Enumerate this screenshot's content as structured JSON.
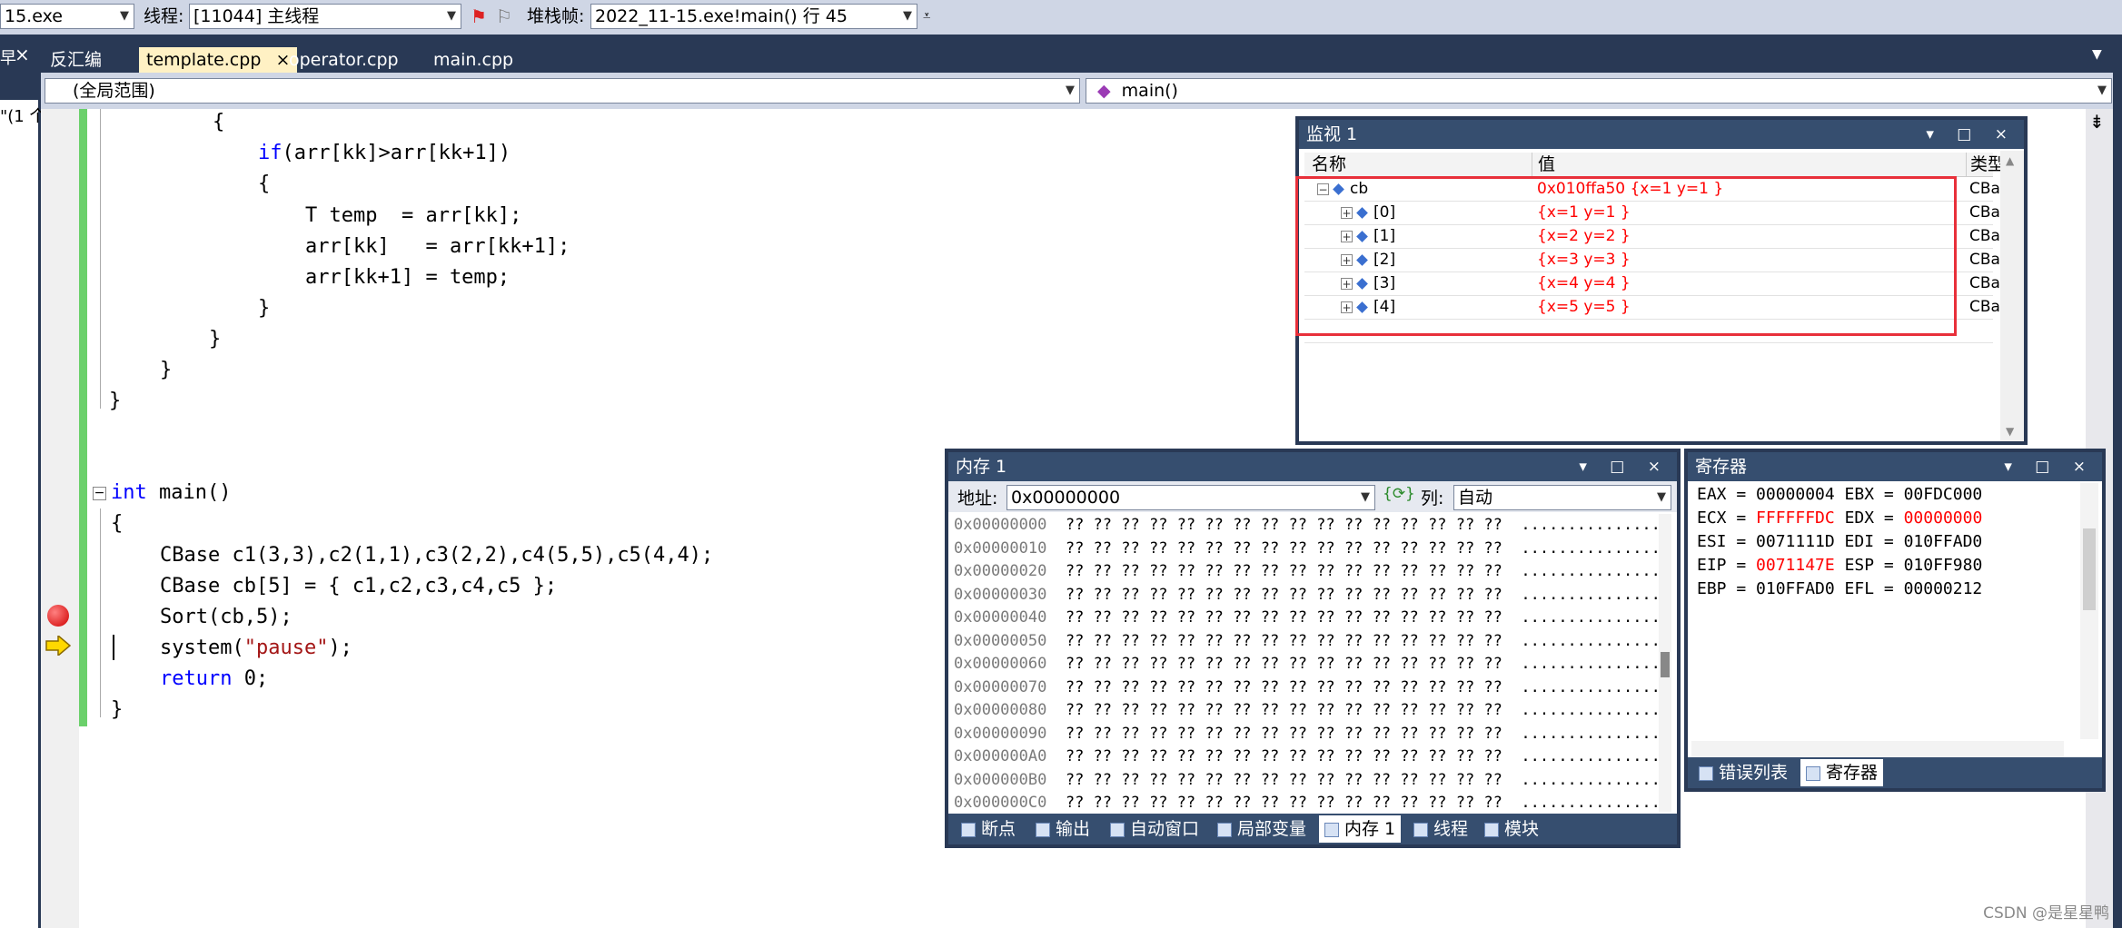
{
  "toolbar": {
    "process": "15.exe",
    "thread_label": "线程:",
    "thread_value": "[11044] 主线程",
    "stack_label": "堆栈帧:",
    "stack_value": "2022_11-15.exe!main()  行 45"
  },
  "left_panel": {
    "close": "×",
    "fragment": "\"(1 个"
  },
  "tabs": [
    {
      "label": "反汇编"
    },
    {
      "label": "template.cpp",
      "active": true,
      "close": "×"
    },
    {
      "label": "operator.cpp"
    },
    {
      "label": "main.cpp"
    }
  ],
  "scope": {
    "left": "(全局范围)",
    "right": "main()"
  },
  "code": {
    "l1": "{",
    "l2_kw": "if",
    "l2_rest": "(arr[kk]>arr[kk+1])",
    "l3": "{",
    "l4": "T temp  = arr[kk];",
    "l5": "arr[kk]   = arr[kk+1];",
    "l6": "arr[kk+1] = temp;",
    "l7": "}",
    "l8": "}",
    "l9": "}",
    "l10": "}",
    "main_kw": "int",
    "main_rest": " main()",
    "open": "{",
    "c1": "CBase c1(3,3),c2(1,1),c3(2,2),c4(5,5),c5(4,4);",
    "c2": "CBase cb[5] = { c1,c2,c3,c4,c5 };",
    "c3": "Sort(cb,5);",
    "c4_a": "system(",
    "c4_str": "\"pause\"",
    "c4_b": ");",
    "c5_kw": "return",
    "c5_rest": " 0;",
    "close": "}",
    "collapse": "−"
  },
  "watch": {
    "title": "监视 1",
    "buttons": "▾ □ ×",
    "col_name": "名称",
    "col_value": "值",
    "col_type": "类型",
    "rows": [
      {
        "name": "cb",
        "value": "0x010ffa50 {x=1 y=1 }",
        "type": "CBase",
        "expander": "−"
      },
      {
        "name": "[0]",
        "value": "{x=1 y=1 }",
        "type": "CBase",
        "expander": "+"
      },
      {
        "name": "[1]",
        "value": "{x=2 y=2 }",
        "type": "CBase",
        "expander": "+"
      },
      {
        "name": "[2]",
        "value": "{x=3 y=3 }",
        "type": "CBase",
        "expander": "+"
      },
      {
        "name": "[3]",
        "value": "{x=4 y=4 }",
        "type": "CBase",
        "expander": "+"
      },
      {
        "name": "[4]",
        "value": "{x=5 y=5 }",
        "type": "CBase",
        "expander": "+"
      }
    ]
  },
  "memory": {
    "title": "内存 1",
    "buttons": "▾ □ ×",
    "addr_label": "地址:",
    "addr_value": "0x00000000",
    "col_label": "列:",
    "col_value": "自动",
    "bytes": "?? ?? ?? ?? ?? ?? ?? ?? ?? ?? ?? ?? ?? ?? ?? ??",
    "ascii": "................",
    "addresses": [
      "0x00000000",
      "0x00000010",
      "0x00000020",
      "0x00000030",
      "0x00000040",
      "0x00000050",
      "0x00000060",
      "0x00000070",
      "0x00000080",
      "0x00000090",
      "0x000000A0",
      "0x000000B0",
      "0x000000C0"
    ]
  },
  "registers": {
    "title": "寄存器",
    "buttons": "▾ □ ×",
    "r1": "EAX = 00000004 EBX = 00FDC000",
    "r2_a": "ECX = ",
    "r2_red1": "FFFFFFDC",
    "r2_b": " EDX = ",
    "r2_red2": "00000000",
    "r3": "ESI = 0071111D EDI = 010FFAD0",
    "r4_a": "EIP = ",
    "r4_red": "0071147E",
    "r4_b": " ESP = 010FF980",
    "r5": "EBP = 010FFAD0 EFL = 00000212"
  },
  "bottom_tabs_left": [
    "断点",
    "输出",
    "自动窗口",
    "局部变量",
    "内存 1",
    "线程",
    "模块"
  ],
  "bottom_tabs_right": [
    "错误列表",
    "寄存器"
  ],
  "watermark": "CSDN @是星星鸭",
  "colors": {
    "highlight": "#ff0000",
    "keyword": "#0000ff",
    "string": "#a31515",
    "panel_title": "#364e6f"
  }
}
